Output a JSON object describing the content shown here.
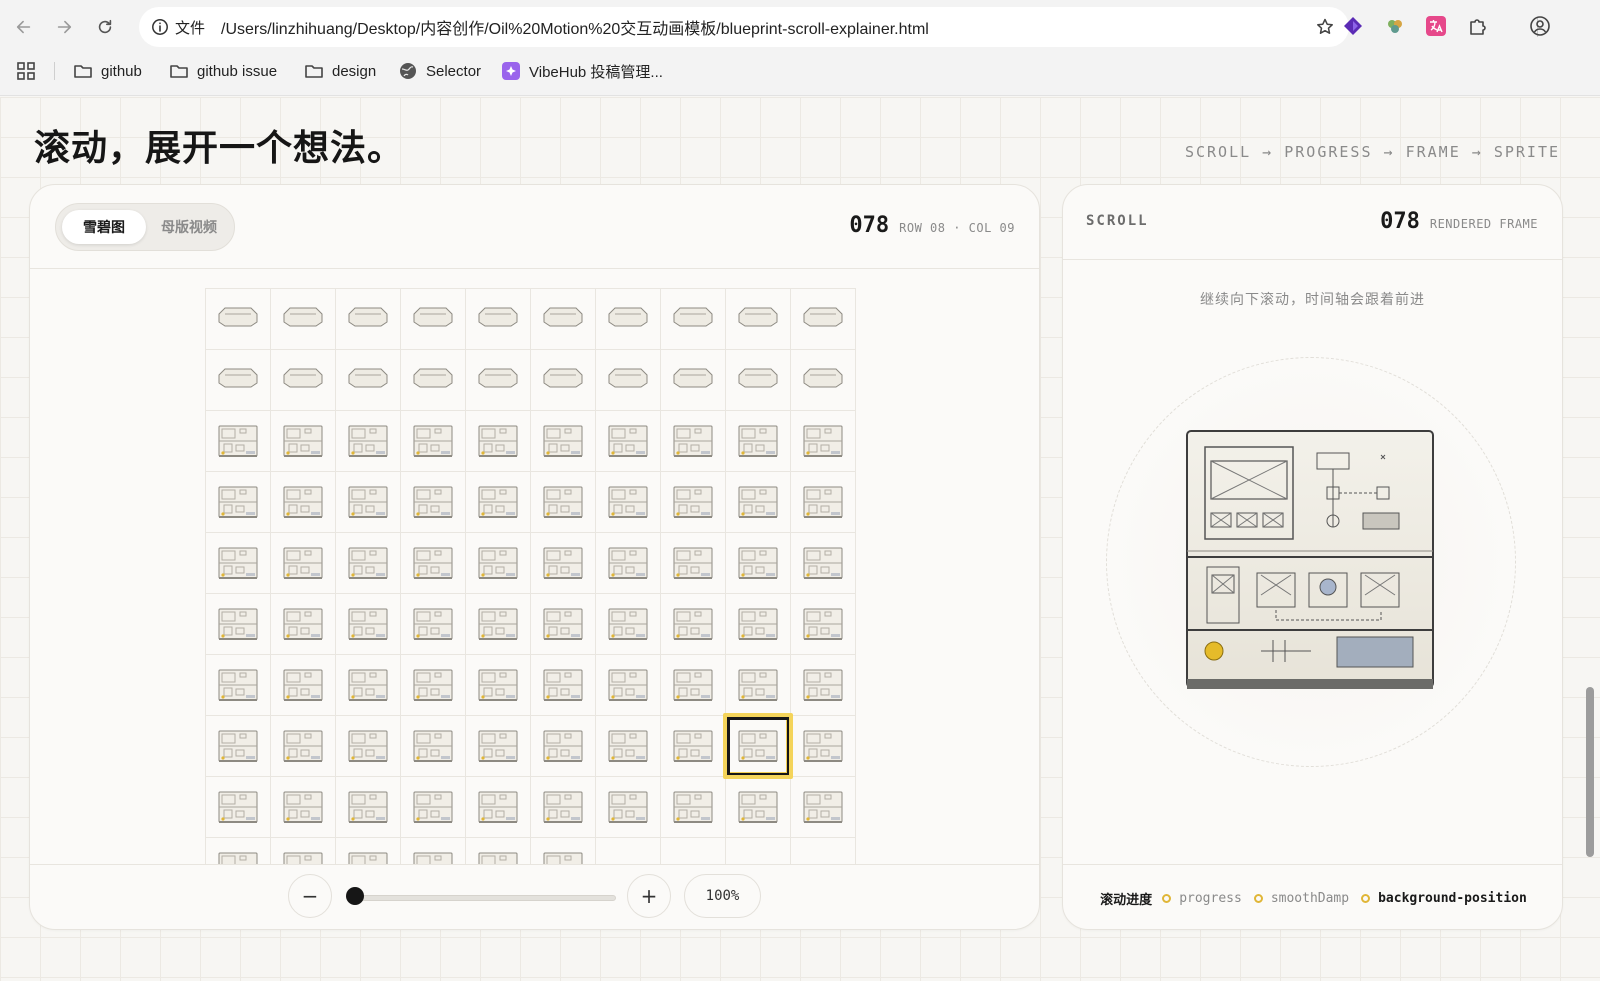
{
  "browser": {
    "scheme_label": "文件",
    "url": "/Users/linzhihuang/Desktop/内容创作/Oil%20Motion%20交互动画模板/blueprint-scroll-explainer.html",
    "bookmarks": [
      {
        "label": "github",
        "icon": "folder-icon"
      },
      {
        "label": "github issue",
        "icon": "folder-icon"
      },
      {
        "label": "design",
        "icon": "folder-icon"
      },
      {
        "label": "Selector",
        "icon": "globe-icon"
      },
      {
        "label": "VibeHub 投稿管理...",
        "icon": "vibehub-icon"
      }
    ]
  },
  "page": {
    "title": "滚动，展开一个想法。",
    "pipeline": "SCROLL → PROGRESS → FRAME → SPRITE"
  },
  "sprite_panel": {
    "tabs": [
      {
        "label": "雪碧图",
        "active": true
      },
      {
        "label": "母版视频",
        "active": false
      }
    ],
    "frame_number": "078",
    "row_col": "ROW 08 · COL 09",
    "grid": {
      "columns": 10,
      "visible_rows": 10,
      "frames_in_last_row": 6,
      "current_row": 8,
      "current_col": 9
    },
    "zoom_minus": "−",
    "zoom_plus": "+",
    "zoom_value": "100%",
    "zoom_slider_value": 0
  },
  "render_panel": {
    "label": "SCROLL",
    "frame_number": "078",
    "frame_caption": "RENDERED FRAME",
    "hint": "继续向下滚动，时间轴会跟着前进",
    "legend_title": "滚动进度",
    "legend": [
      {
        "label": "progress",
        "active": false
      },
      {
        "label": "smoothDamp",
        "active": false
      },
      {
        "label": "background-position",
        "active": true
      }
    ]
  },
  "colors": {
    "accent": "#e0b637",
    "ink": "#161616",
    "page_bg": "#f7f6f3"
  }
}
